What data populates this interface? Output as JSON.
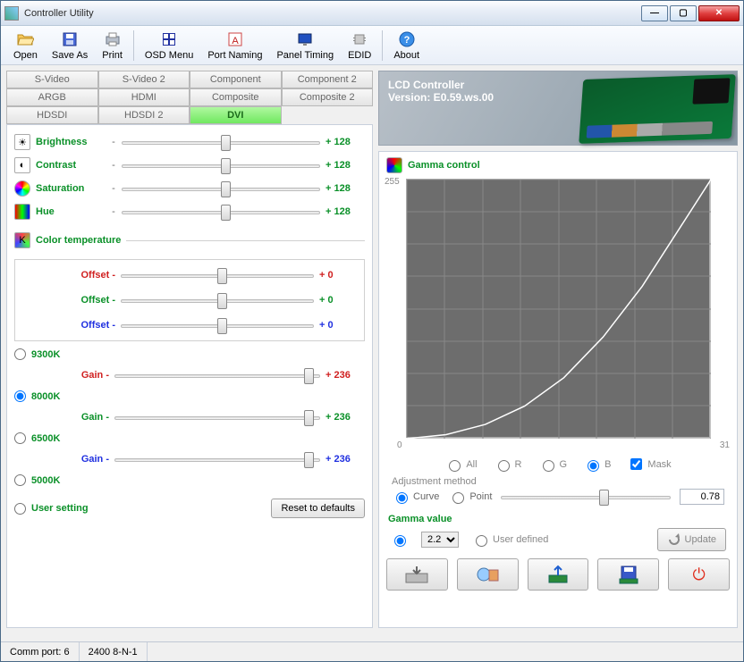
{
  "window": {
    "title": "Controller Utility"
  },
  "toolbar": {
    "open": "Open",
    "saveas": "Save As",
    "print": "Print",
    "osd": "OSD Menu",
    "portnaming": "Port Naming",
    "paneltiming": "Panel Timing",
    "edid": "EDID",
    "about": "About"
  },
  "tabs": [
    "S-Video",
    "S-Video 2",
    "Component",
    "Component 2",
    "ARGB",
    "HDMI",
    "Composite",
    "Composite 2",
    "HDSDI",
    "HDSDI 2",
    "DVI",
    ""
  ],
  "active_tab": "DVI",
  "sliders": {
    "brightness": {
      "label": "Brightness",
      "value": "+ 128"
    },
    "contrast": {
      "label": "Contrast",
      "value": "+ 128"
    },
    "saturation": {
      "label": "Saturation",
      "value": "+ 128"
    },
    "hue": {
      "label": "Hue",
      "value": "+ 128"
    }
  },
  "color_temp": {
    "header": "Color temperature",
    "offset_label": "Offset",
    "offsets": {
      "r": "+ 0",
      "g": "+ 0",
      "b": "+ 0"
    },
    "presets": [
      "9300K",
      "8000K",
      "6500K",
      "5000K"
    ],
    "selected": "8000K",
    "gain_label": "Gain",
    "gains": {
      "r": "+ 236",
      "g": "+ 236",
      "b": "+ 236"
    },
    "user": "User setting",
    "reset": "Reset to defaults"
  },
  "lcd": {
    "title": "LCD Controller",
    "ver": "Version: E0.59.ws.00"
  },
  "gamma": {
    "header": "Gamma control",
    "ymax": "255",
    "xmin": "0",
    "xmax": "31",
    "channels": {
      "all": "All",
      "r": "R",
      "g": "G",
      "b": "B",
      "mask": "Mask"
    },
    "selected_channel": "B",
    "mask_checked": true,
    "adj_label": "Adjustment method",
    "curve": "Curve",
    "point": "Point",
    "adj_selected": "Curve",
    "adj_value": "0.78",
    "value_header": "Gamma value",
    "preset": "2.2",
    "user": "User defined",
    "update": "Update",
    "mode": "preset"
  },
  "chart_data": {
    "type": "line",
    "title": "Gamma control",
    "xlabel": "",
    "ylabel": "",
    "xlim": [
      0,
      31
    ],
    "ylim": [
      0,
      255
    ],
    "x": [
      0,
      4,
      8,
      12,
      16,
      20,
      24,
      28,
      31
    ],
    "values": [
      0,
      4,
      14,
      32,
      60,
      100,
      150,
      210,
      255
    ]
  },
  "status": {
    "port": "Comm port: 6",
    "cfg": "2400 8-N-1"
  }
}
